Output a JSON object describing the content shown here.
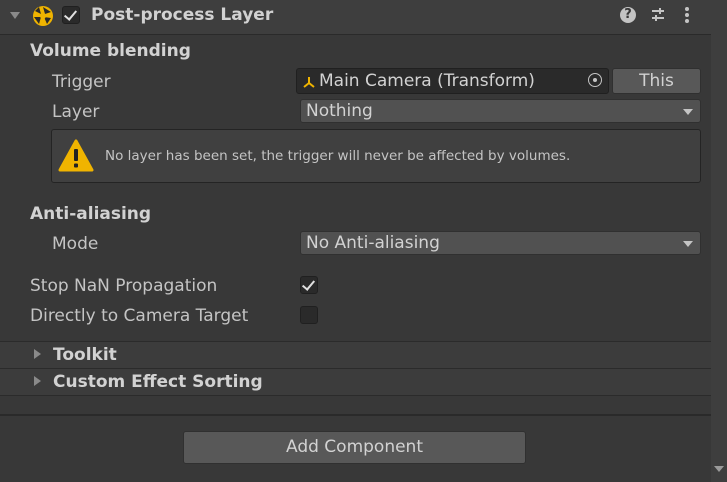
{
  "component": {
    "title": "Post-process Layer",
    "enabled": true,
    "icons": {
      "component": "post-process-icon",
      "help": "help-icon",
      "presets": "presets-icon",
      "menu": "kebab-menu-icon"
    }
  },
  "volume_blending": {
    "section_label": "Volume blending",
    "trigger": {
      "label": "Trigger",
      "value": "Main Camera (Transform)",
      "button": "This",
      "icon": "transform-icon"
    },
    "layer": {
      "label": "Layer",
      "value": "Nothing"
    },
    "warning": {
      "icon": "warning-icon",
      "text": "No layer has been set, the trigger will never be affected by volumes."
    }
  },
  "anti_aliasing": {
    "section_label": "Anti-aliasing",
    "mode": {
      "label": "Mode",
      "value": "No Anti-aliasing"
    }
  },
  "options": {
    "stop_nan": {
      "label": "Stop NaN Propagation",
      "checked": true
    },
    "direct_to_camera": {
      "label": "Directly to Camera Target",
      "checked": false
    }
  },
  "foldouts": [
    {
      "label": "Toolkit",
      "expanded": false
    },
    {
      "label": "Custom Effect Sorting",
      "expanded": false
    }
  ],
  "add_component": {
    "label": "Add Component"
  }
}
